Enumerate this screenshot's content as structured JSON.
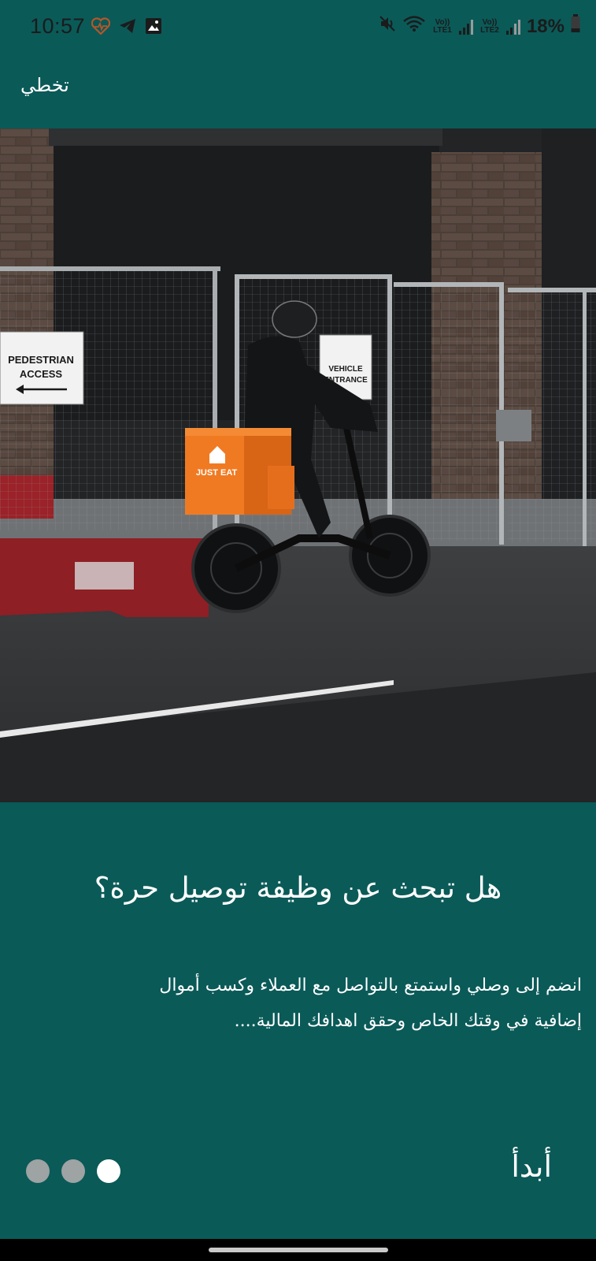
{
  "status_bar": {
    "time": "10:57",
    "net1": "Vo)) LTE1",
    "net2": "Vo)) LTE2",
    "battery": "18%",
    "icons": [
      "heart-rate-icon",
      "telegram-icon",
      "gallery-icon",
      "mute-icon",
      "wifi-icon",
      "signal-icon",
      "battery-icon"
    ]
  },
  "app_bar": {
    "skip_label": "تخطي"
  },
  "hero": {
    "sign_pedestrian": "PEDESTRIAN ACCESS",
    "sign_vehicle": "VEHICLE ENTRANCE",
    "bag_text": "JUST EAT"
  },
  "content": {
    "headline": "هل تبحث عن وظيفة توصيل حرة؟",
    "body_line1": "انضم إلى وصلي واستمتع بالتواصل مع العملاء وكسب أموال",
    "body_line2": "إضافية في وقتك الخاص وحقق اهدافك المالية...."
  },
  "pager": {
    "page_count": 3,
    "active_index": 3
  },
  "actions": {
    "start_label": "أبدأ"
  },
  "colors": {
    "background": "#0a5a58",
    "text": "#ffffff",
    "dot_inactive": "#9ea3a3",
    "dot_active": "#ffffff",
    "accent_bag": "#f07a22"
  }
}
